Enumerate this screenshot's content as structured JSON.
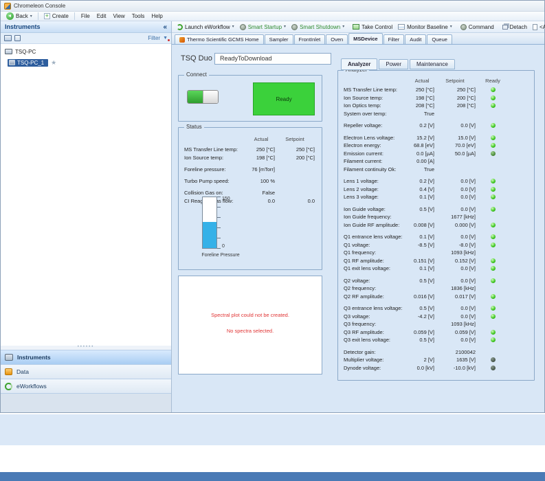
{
  "titlebar": {
    "title": "Chromeleon Console"
  },
  "menubar": {
    "back": "Back",
    "create": "Create",
    "items": [
      {
        "label": "File"
      },
      {
        "label": "Edit"
      },
      {
        "label": "View"
      },
      {
        "label": "Tools"
      },
      {
        "label": "Help"
      }
    ]
  },
  "toolbar": {
    "launch": "Launch eWorkflow",
    "smart_startup": "Smart Startup",
    "smart_shutdown": "Smart Shutdown",
    "take_control": "Take Control",
    "monitor_baseline": "Monitor Baseline",
    "command": "Command",
    "detach": "Detach",
    "autogenerated": "<Autogenerated>"
  },
  "sidebar": {
    "header": "Instruments",
    "filter": "Filter",
    "tree": {
      "root": "TSQ-PC",
      "child": "TSQ-PC_1"
    },
    "nav": [
      {
        "label": "Instruments",
        "cls": "active",
        "icon": "ic-instruments"
      },
      {
        "label": "Data",
        "cls": "",
        "icon": "ic-data"
      },
      {
        "label": "eWorkflows",
        "cls": "",
        "icon": "ic-eworkflows"
      }
    ]
  },
  "tabs": [
    {
      "label": "Thermo Scientific GCMS Home",
      "cls": "hasicon"
    },
    {
      "label": "Sampler",
      "cls": ""
    },
    {
      "label": "FrontInlet",
      "cls": ""
    },
    {
      "label": "Oven",
      "cls": ""
    },
    {
      "label": "MSDevice",
      "cls": "active"
    },
    {
      "label": "Filter",
      "cls": ""
    },
    {
      "label": "Audit",
      "cls": ""
    },
    {
      "label": "Queue",
      "cls": ""
    }
  ],
  "device": {
    "name": "TSQ Duo",
    "state": "ReadyToDownload"
  },
  "connect": {
    "title": "Connect",
    "ready": "Ready"
  },
  "status": {
    "title": "Status",
    "headers": {
      "actual": "Actual",
      "setpoint": "Setpoint"
    },
    "rows": [
      {
        "label": "MS Transfer Line temp:",
        "actual": "250 [°C]",
        "setpoint": "250 [°C]",
        "cls": ""
      },
      {
        "label": "Ion Source temp:",
        "actual": "198 [°C]",
        "setpoint": "200 [°C]",
        "cls": ""
      },
      {
        "label": "Foreline pressure:",
        "actual": "76 [mTorr]",
        "setpoint": "",
        "cls": "gap"
      },
      {
        "label": "Turbo Pump speed:",
        "actual": "100 %",
        "setpoint": "",
        "cls": "gap"
      },
      {
        "label": "Collision Gas on:",
        "actual": "False",
        "setpoint": "",
        "cls": "gap"
      },
      {
        "label": "CI Reagent Gas flow:",
        "actual": "0.0",
        "setpoint": "0.0",
        "cls": ""
      }
    ],
    "gauge": {
      "top": "150",
      "bottom": "0",
      "label": "Foreline Pressure",
      "fill_pct": 51
    }
  },
  "spectral": {
    "line1": "Spectral plot could not be created.",
    "line2": "No spectra selected."
  },
  "ms_tabs": [
    {
      "label": "Analyzer",
      "cls": "active"
    },
    {
      "label": "Power",
      "cls": ""
    },
    {
      "label": "Maintenance",
      "cls": ""
    }
  ],
  "analyzer": {
    "title": "Analyzer",
    "headers": {
      "actual": "Actual",
      "setpoint": "Setpoint",
      "ready": "Ready"
    },
    "rows": [
      {
        "label": "MS Transfer Line temp:",
        "actual": "250 [°C]",
        "setpoint": "250 [°C]",
        "led": "green",
        "cls": ""
      },
      {
        "label": "Ion Source temp:",
        "actual": "198 [°C]",
        "setpoint": "200 [°C]",
        "led": "green",
        "cls": ""
      },
      {
        "label": "Ion Optics temp:",
        "actual": "208 [°C]",
        "setpoint": "208 [°C]",
        "led": "green",
        "cls": ""
      },
      {
        "label": "System over temp:",
        "actual": "True",
        "setpoint": "",
        "led": "noled",
        "cls": ""
      },
      {
        "label": "Repeller voltage:",
        "actual": "0.2 [V]",
        "setpoint": "0.0 [V]",
        "led": "green",
        "cls": "gap"
      },
      {
        "label": "Electron Lens voltage:",
        "actual": "15.2 [V]",
        "setpoint": "15.0 [V]",
        "led": "green",
        "cls": "gap"
      },
      {
        "label": "Electron energy:",
        "actual": "68.8 [eV]",
        "setpoint": "70.0 [eV]",
        "led": "green",
        "cls": ""
      },
      {
        "label": "Emission current:",
        "actual": "0.0 [µA]",
        "setpoint": "50.0 [µA]",
        "led": "dim",
        "cls": ""
      },
      {
        "label": "Filament current:",
        "actual": "0.00 [A]",
        "setpoint": "",
        "led": "noled",
        "cls": ""
      },
      {
        "label": "Filament continuity Ok:",
        "actual": "True",
        "setpoint": "",
        "led": "noled",
        "cls": ""
      },
      {
        "label": "Lens 1 voltage:",
        "actual": "0.2 [V]",
        "setpoint": "0.0 [V]",
        "led": "green",
        "cls": "gap"
      },
      {
        "label": "Lens 2 voltage:",
        "actual": "0.4 [V]",
        "setpoint": "0.0 [V]",
        "led": "green",
        "cls": ""
      },
      {
        "label": "Lens 3 voltage:",
        "actual": "0.1 [V]",
        "setpoint": "0.0 [V]",
        "led": "green",
        "cls": ""
      },
      {
        "label": "Ion Guide voltage:",
        "actual": "0.5 [V]",
        "setpoint": "0.0 [V]",
        "led": "green",
        "cls": "gap"
      },
      {
        "label": "Ion Guide frequency:",
        "actual": "",
        "setpoint": "1677 [kHz]",
        "led": "noled",
        "cls": ""
      },
      {
        "label": "Ion Guide RF amplitude:",
        "actual": "0.008 [V]",
        "setpoint": "0.000 [V]",
        "led": "green",
        "cls": ""
      },
      {
        "label": "Q1 entrance lens voltage:",
        "actual": "0.1 [V]",
        "setpoint": "0.0 [V]",
        "led": "green",
        "cls": "gap"
      },
      {
        "label": "Q1 voltage:",
        "actual": "-8.5 [V]",
        "setpoint": "-8.0 [V]",
        "led": "green",
        "cls": ""
      },
      {
        "label": "Q1 frequency:",
        "actual": "",
        "setpoint": "1093 [kHz]",
        "led": "noled",
        "cls": ""
      },
      {
        "label": "Q1 RF amplitude:",
        "actual": "0.151 [V]",
        "setpoint": "0.152 [V]",
        "led": "green",
        "cls": ""
      },
      {
        "label": "Q1 exit lens voltage:",
        "actual": "0.1 [V]",
        "setpoint": "0.0 [V]",
        "led": "green",
        "cls": ""
      },
      {
        "label": "Q2 voltage:",
        "actual": "0.5 [V]",
        "setpoint": "0.0 [V]",
        "led": "green",
        "cls": "gap"
      },
      {
        "label": "Q2 frequency:",
        "actual": "",
        "setpoint": "1836 [kHz]",
        "led": "noled",
        "cls": ""
      },
      {
        "label": "Q2 RF amplitude:",
        "actual": "0.016 [V]",
        "setpoint": "0.017 [V]",
        "led": "green",
        "cls": ""
      },
      {
        "label": "Q3 entrance lens voltage:",
        "actual": "0.5 [V]",
        "setpoint": "0.0 [V]",
        "led": "green",
        "cls": "gap"
      },
      {
        "label": "Q3 voltage:",
        "actual": "-4.2 [V]",
        "setpoint": "0.0 [V]",
        "led": "green",
        "cls": ""
      },
      {
        "label": "Q3 frequency:",
        "actual": "",
        "setpoint": "1093 [kHz]",
        "led": "noled",
        "cls": ""
      },
      {
        "label": "Q3 RF amplitude:",
        "actual": "0.059 [V]",
        "setpoint": "0.059 [V]",
        "led": "green",
        "cls": ""
      },
      {
        "label": "Q3 exit lens voltage:",
        "actual": "0.5 [V]",
        "setpoint": "0.0 [V]",
        "led": "green",
        "cls": ""
      },
      {
        "label": "Detector gain:",
        "actual": "",
        "setpoint": "2100042",
        "led": "noled",
        "cls": "gap"
      },
      {
        "label": "Multiplier voltage:",
        "actual": "2 [V]",
        "setpoint": "1635 [V]",
        "led": "dark",
        "cls": ""
      },
      {
        "label": "Dynode voltage:",
        "actual": "0.0 [kV]",
        "setpoint": "-10.0 [kV]",
        "led": "dark",
        "cls": ""
      }
    ]
  },
  "icons": {
    "collapse": "«",
    "caret_down": "▾",
    "star": "★",
    "funnel": "▼",
    "grip": "••••••"
  },
  "colors": {
    "content_bg": "#d9e7f6",
    "ready_green": "#3bd13b",
    "selection_blue": "#2d5d9d",
    "gauge_blue": "#35b1e8",
    "error_red": "#e03434",
    "bottom_bar_blue": "#4a7ab5"
  }
}
